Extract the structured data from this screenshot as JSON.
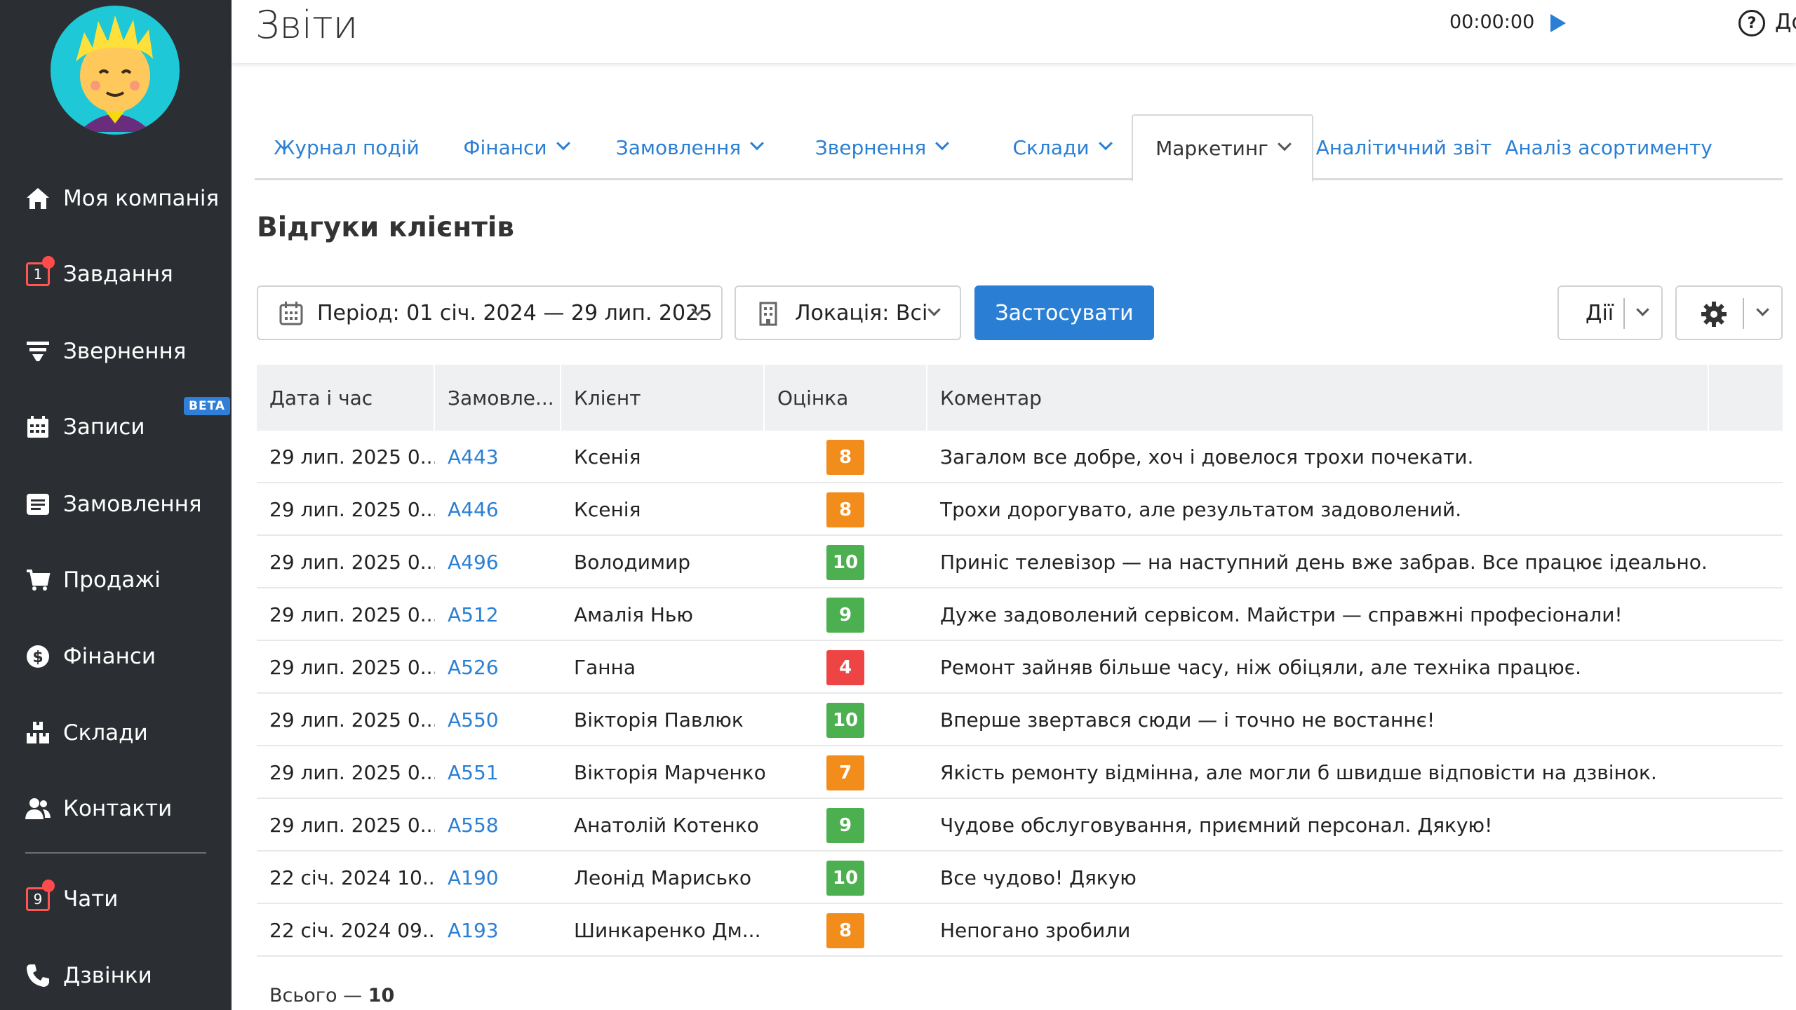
{
  "header": {
    "title": "Звіти",
    "timer": "00:00:00",
    "help_label": "Допомога"
  },
  "sidebar": {
    "items": [
      {
        "label": "Моя компанія",
        "icon": "home-icon"
      },
      {
        "label": "Завдання",
        "icon": "tasks-icon",
        "count": "1"
      },
      {
        "label": "Звернення",
        "icon": "funnel-icon"
      },
      {
        "label": "Записи",
        "icon": "calendar-icon",
        "badge": "BETA"
      },
      {
        "label": "Замовлення",
        "icon": "order-icon"
      },
      {
        "label": "Продажі",
        "icon": "cart-icon"
      },
      {
        "label": "Фінанси",
        "icon": "dollar-icon"
      },
      {
        "label": "Склади",
        "icon": "warehouse-icon"
      },
      {
        "label": "Контакти",
        "icon": "contacts-icon"
      },
      {
        "label": "Чати",
        "icon": "chat-icon",
        "count": "9"
      },
      {
        "label": "Дзвінки",
        "icon": "phone-icon"
      }
    ]
  },
  "tabs": [
    {
      "label": "Журнал подій",
      "dropdown": false,
      "active": false
    },
    {
      "label": "Фінанси",
      "dropdown": true,
      "active": false
    },
    {
      "label": "Замовлення",
      "dropdown": true,
      "active": false
    },
    {
      "label": "Звернення",
      "dropdown": true,
      "active": false
    },
    {
      "label": "Склади",
      "dropdown": true,
      "active": false
    },
    {
      "label": "Маркетинг",
      "dropdown": true,
      "active": true
    },
    {
      "label": "Аналітичний звіт",
      "dropdown": false,
      "active": false
    },
    {
      "label": "Аналіз асортименту",
      "dropdown": false,
      "active": false
    }
  ],
  "section_title": "Відгуки клієнтів",
  "filters": {
    "period": "Період: 01 січ. 2024 — 29 лип. 2025",
    "location": "Локація: Всі",
    "apply": "Застосувати",
    "actions": "Дії"
  },
  "table": {
    "columns": [
      "Дата і час",
      "Замовле...",
      "Клієнт",
      "Оцінка",
      "Коментар"
    ],
    "rows": [
      {
        "date": "29 лип. 2025 0...",
        "order": "A443",
        "client": "Ксенія",
        "score": "8",
        "comment": "Загалом все добре, хоч і довелося трохи почекати."
      },
      {
        "date": "29 лип. 2025 0...",
        "order": "A446",
        "client": "Ксенія",
        "score": "8",
        "comment": "Трохи дорогувато, але результатом задоволений."
      },
      {
        "date": "29 лип. 2025 0...",
        "order": "A496",
        "client": "Володимир",
        "score": "10",
        "comment": "Приніс телевізор — на наступний день вже забрав. Все працює ідеально."
      },
      {
        "date": "29 лип. 2025 0...",
        "order": "A512",
        "client": "Амалія Нью",
        "score": "9",
        "comment": "Дуже задоволений сервісом. Майстри — справжні професіонали!"
      },
      {
        "date": "29 лип. 2025 0...",
        "order": "A526",
        "client": "Ганна",
        "score": "4",
        "comment": "Ремонт зайняв більше часу, ніж обіцяли, але техніка працює."
      },
      {
        "date": "29 лип. 2025 0...",
        "order": "A550",
        "client": "Вікторія Павлюк",
        "score": "10",
        "comment": "Вперше звертався сюди — і точно не востаннє!"
      },
      {
        "date": "29 лип. 2025 0...",
        "order": "A551",
        "client": "Вікторія Марченко",
        "score": "7",
        "comment": "Якість ремонту відмінна, але могли б швидше відповісти на дзвінок."
      },
      {
        "date": "29 лип. 2025 0...",
        "order": "A558",
        "client": "Анатолій Котенко",
        "score": "9",
        "comment": "Чудове обслуговування, приємний персонал. Дякую!"
      },
      {
        "date": "22 січ. 2024 10...",
        "order": "A190",
        "client": "Леонід Марисько",
        "score": "10",
        "comment": "Все чудово! Дякую"
      },
      {
        "date": "22 січ. 2024 09...",
        "order": "A193",
        "client": "Шинкаренко Дм...",
        "score": "8",
        "comment": "Непогано зробили"
      }
    ]
  },
  "total_label": "Всього —",
  "total_value": "10",
  "colors": {
    "score_orange": "#f28c1b",
    "score_green": "#4caf50",
    "score_red": "#ef4444",
    "accent": "#2a7fd4"
  }
}
